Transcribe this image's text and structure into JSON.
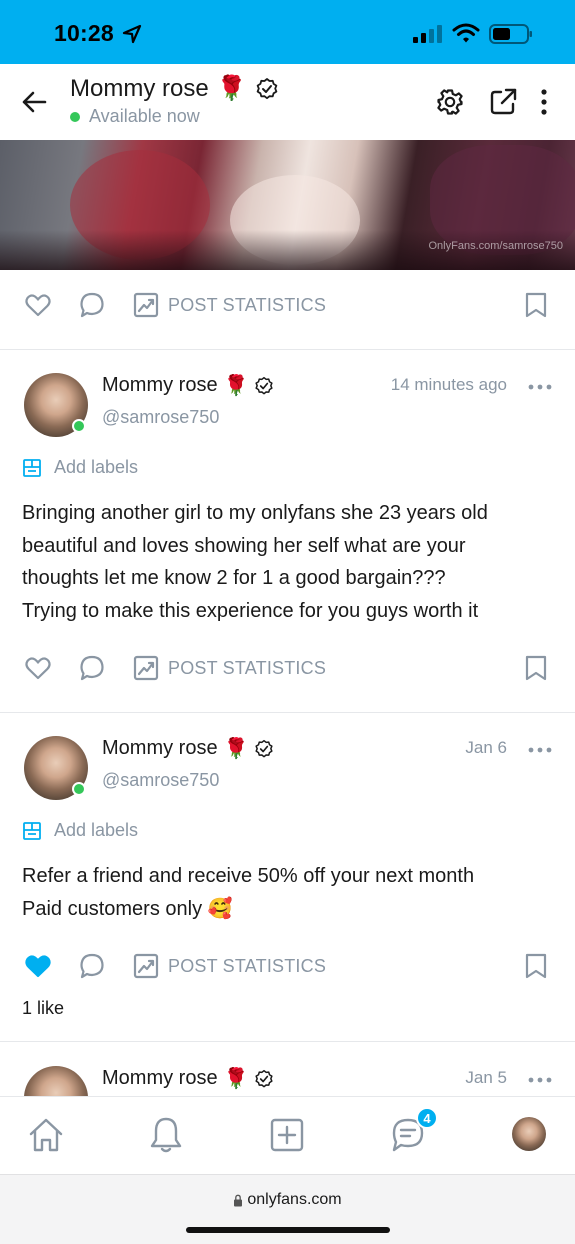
{
  "status_bar": {
    "time": "10:28"
  },
  "header": {
    "name": "Mommy rose",
    "status": "Available now"
  },
  "banner": {
    "watermark": "OnlyFans.com/samrose750"
  },
  "actions": {
    "stats_label": "POST STATISTICS"
  },
  "posts": [
    {
      "name": "Mommy rose",
      "handle": "@samrose750",
      "time": "14 minutes ago",
      "labels": "Add labels",
      "text": [
        "Bringing another girl to my onlyfans she 23 years old",
        "beautiful and loves showing her self what are your",
        "thoughts let me know 2 for 1 a good bargain???",
        "Trying to make this experience for you guys worth it"
      ],
      "liked": false
    },
    {
      "name": "Mommy rose",
      "handle": "@samrose750",
      "time": "Jan 6",
      "labels": "Add labels",
      "text": [
        "Refer a friend and receive 50% off your next month",
        "Paid customers only 🥰"
      ],
      "liked": true,
      "likes": "1 like"
    },
    {
      "name": "Mommy rose",
      "time": "Jan 5"
    }
  ],
  "tab_bar": {
    "messages_badge": "4"
  },
  "browser": {
    "url": "onlyfans.com"
  },
  "colors": {
    "accent": "#00aff0",
    "online": "#34c759",
    "muted": "#8a96a3"
  }
}
